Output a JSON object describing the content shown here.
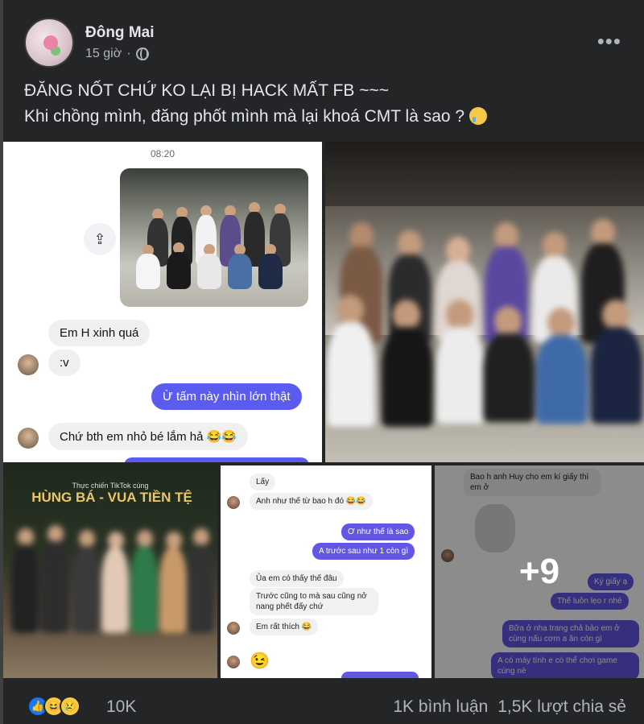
{
  "post": {
    "author": "Đông Mai",
    "time": "15 giờ",
    "text_line1": "ĐĂNG NỐT CHỨ KO LẠI BỊ HACK MẤT FB ~~~",
    "text_line2": "Khi chồng mình, đăng phốt  mình mà lại khoá CMT là sao ?",
    "icons": {
      "privacy": "globe-icon",
      "more": "more-options-icon",
      "emoji": "crying-face-icon"
    }
  },
  "chat1": {
    "time": "08:20",
    "msg1": "Em H  xinh quá",
    "msg2": ":v",
    "msg3": "Ừ tấm này nhìn lớn thật",
    "msg4": "Chứ bth em nhỏ bé lắm hả 😂😂"
  },
  "banner": {
    "subtitle": "Thực chiến TikTok cùng",
    "title": "HÙNG BÁ - VUA TIỀN TỆ"
  },
  "chat2": {
    "msg1": "Lấy",
    "msg2": "Anh như thế từ bao h đó 😂😂",
    "msg3": "Ơ như thế là sao",
    "msg4": "A trước sau như 1 còn gì",
    "msg5": "Ủa em có thấy thế đâu",
    "msg6": "Trước cũng to mà sau cũng nở nang phết đấy chứ",
    "msg7": "Em rất thích 😂",
    "msg8": "😉"
  },
  "chat3": {
    "msg1": "Bao h anh Huy cho em kí giấy thì em ở",
    "msg2": "Ký giấy ạ",
    "msg3": "Thế luôn lẹo r nhé",
    "msg4": "Bữa ở nha trang chả bảo em ở cùng nấu cơm a ăn còn gì",
    "msg5": "A có máy tính e có thể chơi game cùng nè",
    "more_overlay": "+9"
  },
  "footer": {
    "reaction_count": "10K",
    "comments": "1K bình luận",
    "shares": "1,5K lượt chia sẻ"
  },
  "colors": {
    "bg": "#242526",
    "text": "#e4e6eb",
    "secondary": "#b0b3b8",
    "messenger_blue": "#5b5bf0",
    "like_blue": "#1877f2"
  }
}
